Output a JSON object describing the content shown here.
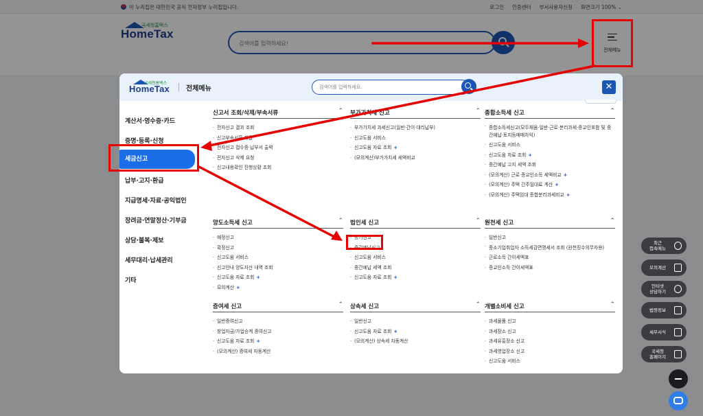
{
  "topbar": {
    "notice": "이 누리집은 대한민국 공식 전자정부 누리집입니다.",
    "links": [
      "로그인",
      "인증센터",
      "부서사용자신청",
      "화면크기 100% ⌄"
    ]
  },
  "logo": {
    "sub": "국세청홈택스",
    "main": "HomeTax"
  },
  "header": {
    "search_placeholder": "검색어를 입력하세요!",
    "allmenu_label": "전체메뉴"
  },
  "modal": {
    "title": "전체메뉴",
    "search_placeholder": "검색어를 입력하세요.",
    "close": "✕",
    "side": [
      "계산서·영수증·카드",
      "증명·등록·신청",
      "세금신고",
      "납부·고지·환급",
      "지급명세·자료·공익법인",
      "장려금·연말정산·기부금",
      "상담·불복·제보",
      "세무대리·납세관리",
      "기타"
    ],
    "categories": [
      {
        "title": "신고서 조회/삭제/부속서류",
        "items": [
          {
            "t": "전자신고 결과 조회"
          },
          {
            "t": "신고부속서류 제출"
          },
          {
            "t": "전자신고 접수증·납부서 출력"
          },
          {
            "t": "전자신고 삭제 요청"
          },
          {
            "t": "신고내용확인 진행상황 조회"
          }
        ]
      },
      {
        "title": "부가가치세 신고",
        "items": [
          {
            "t": "부가가치세 과세신고(일반·간이·대리납부)"
          },
          {
            "t": "신고도움 서비스"
          },
          {
            "t": "신고도움 자료 조회",
            "plus": "+"
          },
          {
            "t": "(모의계산)부가가치세 세액비교"
          }
        ]
      },
      {
        "title": "종합소득세 신고",
        "items": [
          {
            "t": "종합소득세신고(모두채움·일반·근로·분리과세·종교인포함 및 중간예납·토지등매매차익)",
            "wrap": true
          },
          {
            "t": "신고도움 서비스"
          },
          {
            "t": "신고도움 자료 조회",
            "plus": "+"
          },
          {
            "t": "중간예납 고지 세액 조회"
          },
          {
            "t": "(모의계산) 근로·종교인소득 세액비교",
            "plus": "+"
          },
          {
            "t": "(모의계산) 주택 간주임대료 계산",
            "plus": "+"
          },
          {
            "t": "(모의계산) 주택임대 종합분리과세비교",
            "plus": "+"
          }
        ]
      },
      {
        "title": "양도소득세 신고",
        "items": [
          {
            "t": "예정신고"
          },
          {
            "t": "확정신고"
          },
          {
            "t": "신고도움 서비스"
          },
          {
            "t": "신고안내 양도자산 내역 조회"
          },
          {
            "t": "신고도움 자료 조회",
            "plus": "+"
          },
          {
            "t": "모의계산",
            "plus": "+"
          }
        ]
      },
      {
        "title": "법인세 신고",
        "items": [
          {
            "t": "정기신고"
          },
          {
            "t": "중간예납신고"
          },
          {
            "t": "신고도움 서비스"
          },
          {
            "t": "중간예납 세액 조회"
          },
          {
            "t": "신고도움 자료 조회",
            "plus": "+"
          }
        ]
      },
      {
        "title": "원천세 신고",
        "items": [
          {
            "t": "일반신고"
          },
          {
            "t": "중소기업취업자 소득세감면명세서 조회 (원천징수의무자용)",
            "wrap": true
          },
          {
            "t": "근로소득 간이세액표"
          },
          {
            "t": "종교인소득 간이세액표"
          }
        ]
      },
      {
        "title": "증여세 신고",
        "items": [
          {
            "t": "일반증여신고"
          },
          {
            "t": "창업자금/가업승계 증여신고"
          },
          {
            "t": "신고도움 자료 조회",
            "plus": "+"
          },
          {
            "t": "(모의계산) 증여세 자동계산"
          }
        ]
      },
      {
        "title": "상속세 신고",
        "items": [
          {
            "t": "일반신고"
          },
          {
            "t": "신고도움 자료 조회",
            "plus": "+"
          },
          {
            "t": "(모의계산) 상속세 자동계산"
          }
        ]
      },
      {
        "title": "개별소비세 신고",
        "items": [
          {
            "t": "과세물품 신고"
          },
          {
            "t": "과세장소 신고"
          },
          {
            "t": "과세유흥장소 신고"
          },
          {
            "t": "과세영업장소 신고"
          },
          {
            "t": "신고도움 서비스"
          }
        ]
      }
    ],
    "caret": "⌃"
  },
  "quick_menu": [
    {
      "label": "최근\n접속메뉴",
      "icon": "clock-icon"
    },
    {
      "label": "모의계산",
      "icon": "calculator-icon"
    },
    {
      "label": "인터넷\n상담하기",
      "icon": "chat-icon"
    },
    {
      "label": "법령정보",
      "icon": "book-icon"
    },
    {
      "label": "세무서식",
      "icon": "document-icon"
    },
    {
      "label": "국세청\n홈페이지",
      "icon": "building-icon"
    }
  ],
  "colors": {
    "brand": "#1c56b5",
    "active": "#1c6ee8",
    "annotation": "#e60000"
  }
}
